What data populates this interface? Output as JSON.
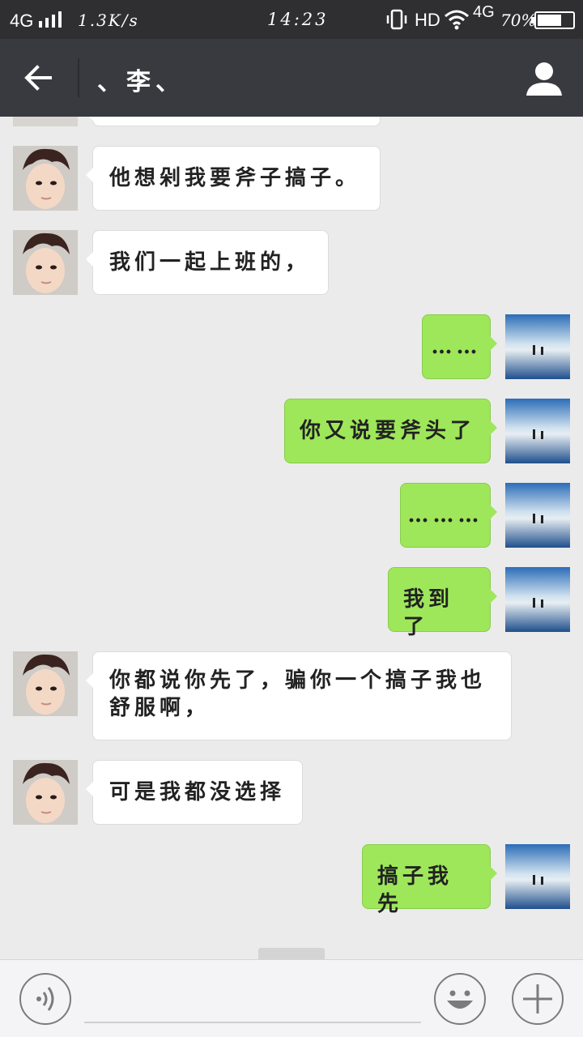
{
  "status_bar": {
    "network": "4G",
    "speed": "1.3K/s",
    "time": "14:23",
    "hd": "HD",
    "network2": "4G",
    "battery_percent": "70%",
    "battery_level": 0.7
  },
  "header": {
    "title": "、李、",
    "back_icon": "arrow-left-icon",
    "profile_icon": "person-icon"
  },
  "messages": [
    {
      "side": "left",
      "text": "他想剁我要斧子搞子。"
    },
    {
      "side": "left",
      "text": "我们一起上班的，"
    },
    {
      "side": "right",
      "text": "……"
    },
    {
      "side": "right",
      "text": "你又说要斧头了"
    },
    {
      "side": "right",
      "text": "………"
    },
    {
      "side": "right",
      "text": "我到了"
    },
    {
      "side": "left",
      "text": "你都说你先了，骗你一个搞子我也舒服啊，"
    },
    {
      "side": "left",
      "text": "可是我都没选择"
    },
    {
      "side": "right",
      "text": "搞子我先"
    }
  ],
  "input": {
    "voice_icon": "voice-icon",
    "emoji_icon": "emoji-icon",
    "plus_icon": "plus-icon",
    "value": "",
    "placeholder": ""
  },
  "colors": {
    "status_bg": "#2f2f31",
    "header_bg": "#393a3f",
    "chat_bg": "#ebebeb",
    "bubble_left": "#ffffff",
    "bubble_right": "#9ee75a"
  }
}
